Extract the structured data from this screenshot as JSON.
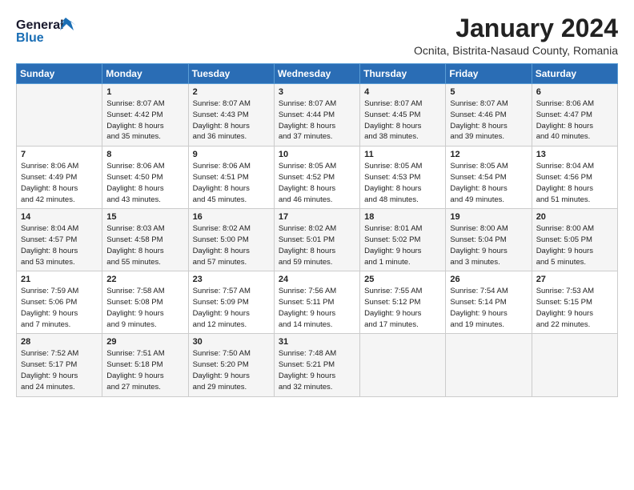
{
  "logo": {
    "line1": "General",
    "line2": "Blue"
  },
  "title": "January 2024",
  "location": "Ocnita, Bistrita-Nasaud County, Romania",
  "days_of_week": [
    "Sunday",
    "Monday",
    "Tuesday",
    "Wednesday",
    "Thursday",
    "Friday",
    "Saturday"
  ],
  "weeks": [
    [
      {
        "day": "",
        "info": ""
      },
      {
        "day": "1",
        "info": "Sunrise: 8:07 AM\nSunset: 4:42 PM\nDaylight: 8 hours\nand 35 minutes."
      },
      {
        "day": "2",
        "info": "Sunrise: 8:07 AM\nSunset: 4:43 PM\nDaylight: 8 hours\nand 36 minutes."
      },
      {
        "day": "3",
        "info": "Sunrise: 8:07 AM\nSunset: 4:44 PM\nDaylight: 8 hours\nand 37 minutes."
      },
      {
        "day": "4",
        "info": "Sunrise: 8:07 AM\nSunset: 4:45 PM\nDaylight: 8 hours\nand 38 minutes."
      },
      {
        "day": "5",
        "info": "Sunrise: 8:07 AM\nSunset: 4:46 PM\nDaylight: 8 hours\nand 39 minutes."
      },
      {
        "day": "6",
        "info": "Sunrise: 8:06 AM\nSunset: 4:47 PM\nDaylight: 8 hours\nand 40 minutes."
      }
    ],
    [
      {
        "day": "7",
        "info": "Sunrise: 8:06 AM\nSunset: 4:49 PM\nDaylight: 8 hours\nand 42 minutes."
      },
      {
        "day": "8",
        "info": "Sunrise: 8:06 AM\nSunset: 4:50 PM\nDaylight: 8 hours\nand 43 minutes."
      },
      {
        "day": "9",
        "info": "Sunrise: 8:06 AM\nSunset: 4:51 PM\nDaylight: 8 hours\nand 45 minutes."
      },
      {
        "day": "10",
        "info": "Sunrise: 8:05 AM\nSunset: 4:52 PM\nDaylight: 8 hours\nand 46 minutes."
      },
      {
        "day": "11",
        "info": "Sunrise: 8:05 AM\nSunset: 4:53 PM\nDaylight: 8 hours\nand 48 minutes."
      },
      {
        "day": "12",
        "info": "Sunrise: 8:05 AM\nSunset: 4:54 PM\nDaylight: 8 hours\nand 49 minutes."
      },
      {
        "day": "13",
        "info": "Sunrise: 8:04 AM\nSunset: 4:56 PM\nDaylight: 8 hours\nand 51 minutes."
      }
    ],
    [
      {
        "day": "14",
        "info": "Sunrise: 8:04 AM\nSunset: 4:57 PM\nDaylight: 8 hours\nand 53 minutes."
      },
      {
        "day": "15",
        "info": "Sunrise: 8:03 AM\nSunset: 4:58 PM\nDaylight: 8 hours\nand 55 minutes."
      },
      {
        "day": "16",
        "info": "Sunrise: 8:02 AM\nSunset: 5:00 PM\nDaylight: 8 hours\nand 57 minutes."
      },
      {
        "day": "17",
        "info": "Sunrise: 8:02 AM\nSunset: 5:01 PM\nDaylight: 8 hours\nand 59 minutes."
      },
      {
        "day": "18",
        "info": "Sunrise: 8:01 AM\nSunset: 5:02 PM\nDaylight: 9 hours\nand 1 minute."
      },
      {
        "day": "19",
        "info": "Sunrise: 8:00 AM\nSunset: 5:04 PM\nDaylight: 9 hours\nand 3 minutes."
      },
      {
        "day": "20",
        "info": "Sunrise: 8:00 AM\nSunset: 5:05 PM\nDaylight: 9 hours\nand 5 minutes."
      }
    ],
    [
      {
        "day": "21",
        "info": "Sunrise: 7:59 AM\nSunset: 5:06 PM\nDaylight: 9 hours\nand 7 minutes."
      },
      {
        "day": "22",
        "info": "Sunrise: 7:58 AM\nSunset: 5:08 PM\nDaylight: 9 hours\nand 9 minutes."
      },
      {
        "day": "23",
        "info": "Sunrise: 7:57 AM\nSunset: 5:09 PM\nDaylight: 9 hours\nand 12 minutes."
      },
      {
        "day": "24",
        "info": "Sunrise: 7:56 AM\nSunset: 5:11 PM\nDaylight: 9 hours\nand 14 minutes."
      },
      {
        "day": "25",
        "info": "Sunrise: 7:55 AM\nSunset: 5:12 PM\nDaylight: 9 hours\nand 17 minutes."
      },
      {
        "day": "26",
        "info": "Sunrise: 7:54 AM\nSunset: 5:14 PM\nDaylight: 9 hours\nand 19 minutes."
      },
      {
        "day": "27",
        "info": "Sunrise: 7:53 AM\nSunset: 5:15 PM\nDaylight: 9 hours\nand 22 minutes."
      }
    ],
    [
      {
        "day": "28",
        "info": "Sunrise: 7:52 AM\nSunset: 5:17 PM\nDaylight: 9 hours\nand 24 minutes."
      },
      {
        "day": "29",
        "info": "Sunrise: 7:51 AM\nSunset: 5:18 PM\nDaylight: 9 hours\nand 27 minutes."
      },
      {
        "day": "30",
        "info": "Sunrise: 7:50 AM\nSunset: 5:20 PM\nDaylight: 9 hours\nand 29 minutes."
      },
      {
        "day": "31",
        "info": "Sunrise: 7:48 AM\nSunset: 5:21 PM\nDaylight: 9 hours\nand 32 minutes."
      },
      {
        "day": "",
        "info": ""
      },
      {
        "day": "",
        "info": ""
      },
      {
        "day": "",
        "info": ""
      }
    ]
  ]
}
